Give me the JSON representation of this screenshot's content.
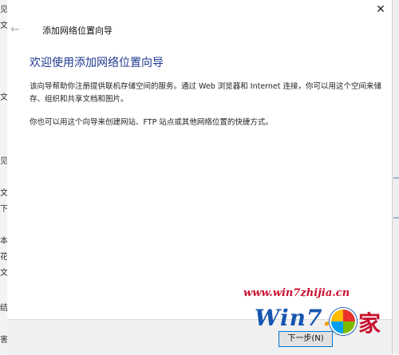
{
  "window": {
    "title": "添加网络位置向导",
    "close_icon": "close-icon",
    "back_icon": "back-arrow-icon"
  },
  "page": {
    "title": "欢迎使用添加网络位置向导",
    "paragraph1": "该向导帮助你注册提供联机存储空间的服务。通过 Web 浏览器和 Internet 连接，你可以用这个空间来储存、组织和共享文档和图片。",
    "paragraph2": "你也可以用这个向导来创建网站、FTP 站点或其他网络位置的快捷方式。"
  },
  "footer": {
    "next_label": "下一步(N)"
  },
  "watermark": {
    "url": "www.win7zhijia.cn",
    "logo": "Win7",
    "logo_dot": ".",
    "jia": "家"
  },
  "left_strip": [
    "见",
    "文",
    "文",
    "见",
    "文",
    "下",
    "本",
    "花",
    "文",
    "结",
    "害"
  ],
  "colors": {
    "title_blue": "#1f3b8f",
    "button_border": "#0078d7",
    "watermark_red": "#c8102e",
    "watermark_blue": "#1656b0"
  }
}
